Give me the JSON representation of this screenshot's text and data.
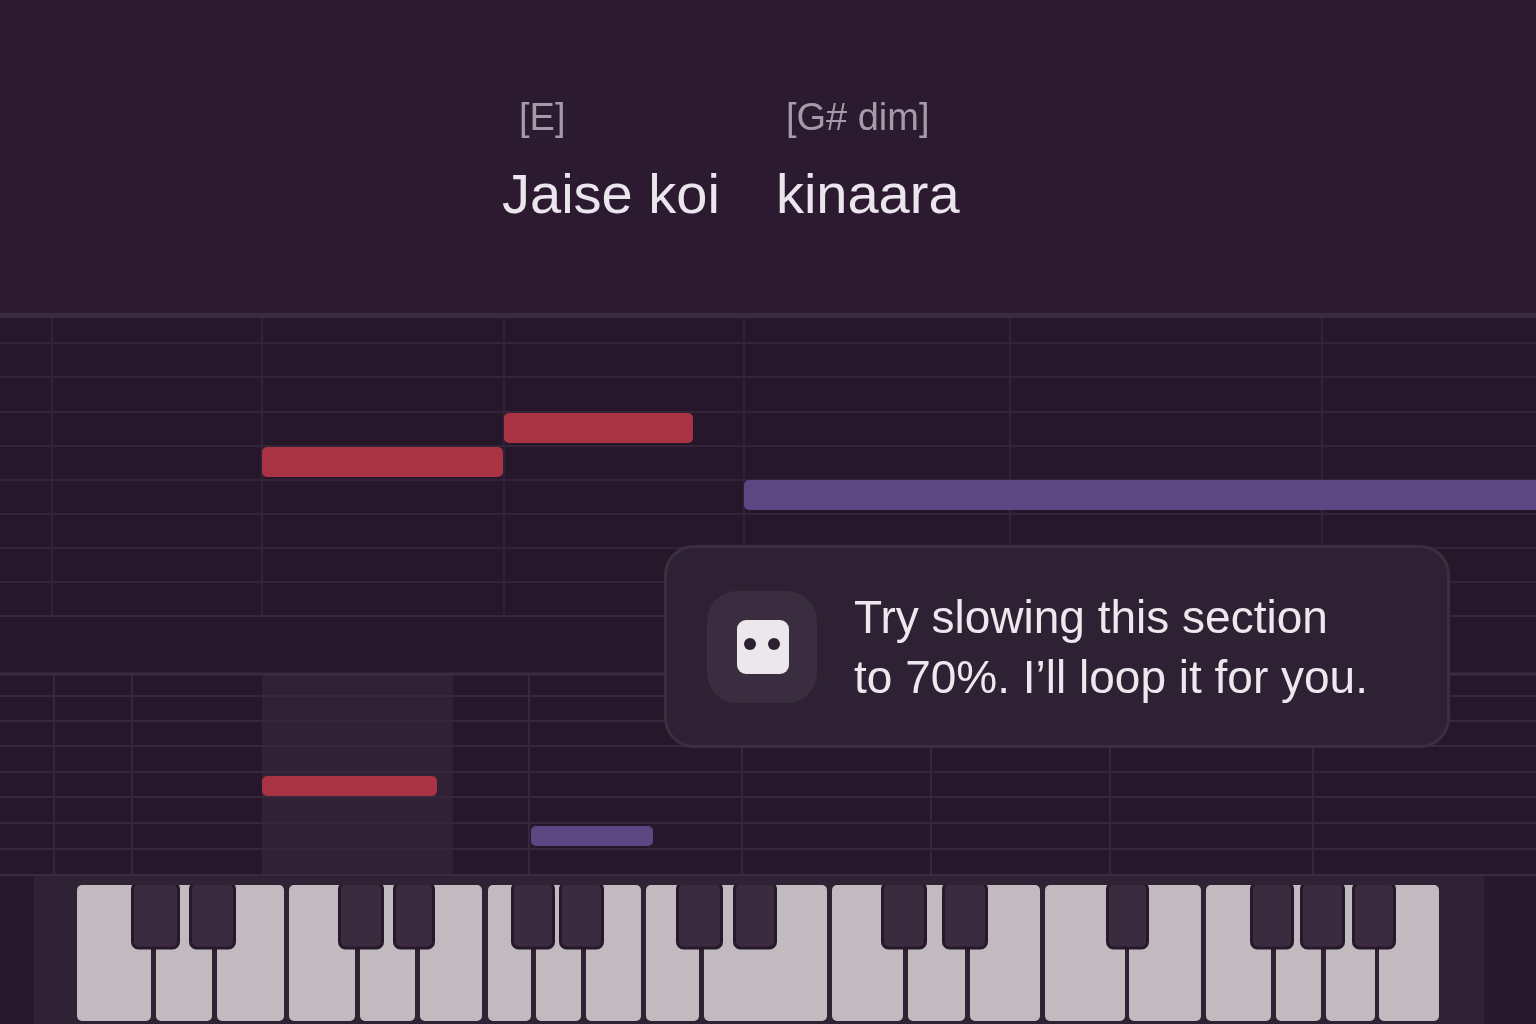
{
  "lyrics": [
    {
      "chord": "[E]",
      "text": "Jaise koi"
    },
    {
      "chord": "[G# dim]",
      "text": "kinaara"
    }
  ],
  "piano_roll": {
    "notes": [
      {
        "color": "#a93343"
      },
      {
        "color": "#a93343"
      },
      {
        "color": "#5c4783"
      },
      {
        "color": "#a93343"
      },
      {
        "color": "#5c4783"
      }
    ]
  },
  "assistant_tip": {
    "message": "Try slowing this section to 70%. I’ll loop it for you."
  }
}
